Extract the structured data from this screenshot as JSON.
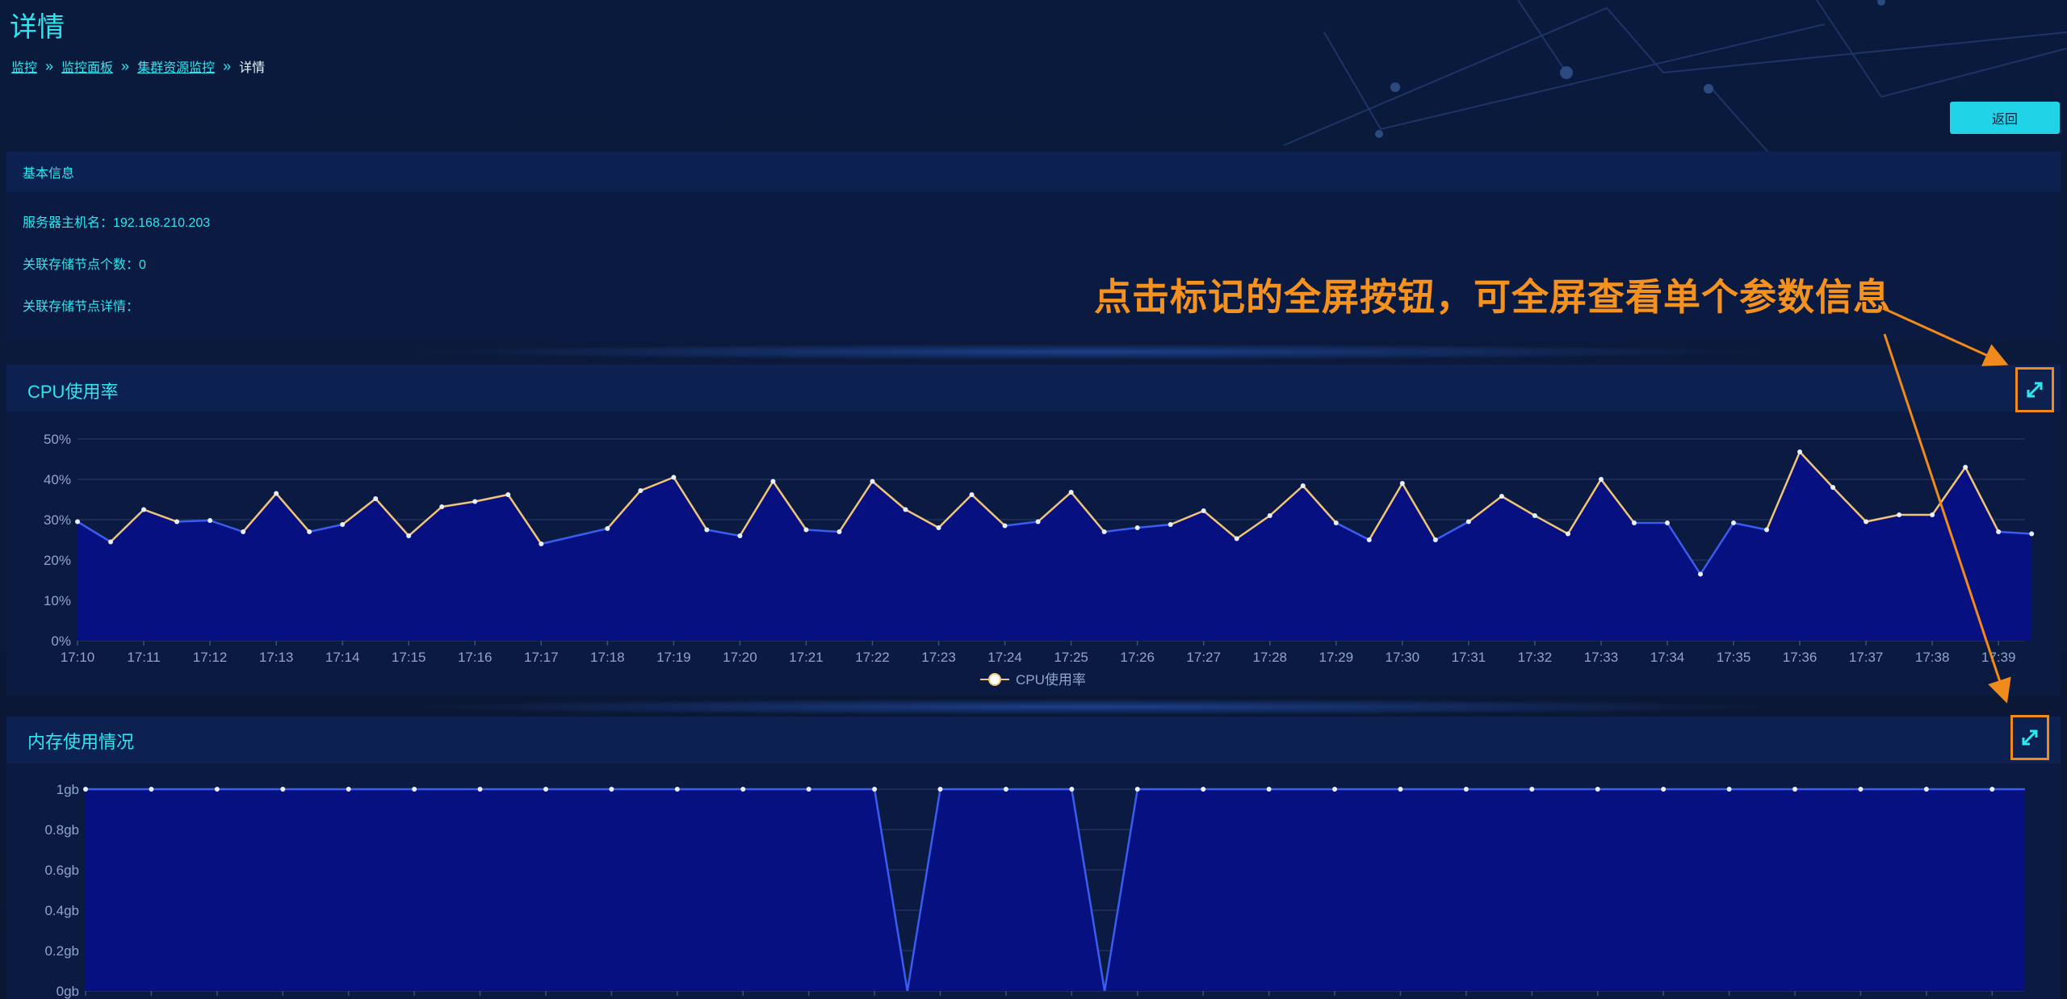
{
  "page": {
    "title": "详情"
  },
  "breadcrumb": [
    {
      "label": "监控",
      "link": true
    },
    {
      "label": "监控面板",
      "link": true
    },
    {
      "label": "集群资源监控",
      "link": true
    },
    {
      "label": "详情",
      "link": false
    }
  ],
  "actions": {
    "back_label": "返回"
  },
  "info_panel": {
    "header": "基本信息",
    "hostname_label": "服务器主机名：192.168.210.203",
    "storage_count_label": "关联存储节点个数：0",
    "storage_detail_label": "关联存储节点详情："
  },
  "annotation": {
    "text": "点击标记的全屏按钮，可全屏查看单个参数信息"
  },
  "icons": {
    "fullscreen": "expand-icon",
    "breadcrumb_separator": "double-chevron-right-icon"
  },
  "colors": {
    "accent": "#2ee6f0",
    "highlight": "#f08a1c",
    "area_fill": "#071080",
    "line": "#3a5cf0",
    "line_warm": "#f0c57a"
  },
  "chart_data": [
    {
      "type": "area",
      "title": "CPU使用率",
      "legend": [
        "CPU使用率"
      ],
      "legend_position": "bottom",
      "x_ticks": [
        "17:10",
        "17:11",
        "17:12",
        "17:13",
        "17:14",
        "17:15",
        "17:16",
        "17:17",
        "17:18",
        "17:19",
        "17:20",
        "17:21",
        "17:22",
        "17:23",
        "17:24",
        "17:25",
        "17:26",
        "17:27",
        "17:28",
        "17:29",
        "17:30",
        "17:31",
        "17:32",
        "17:33",
        "17:34",
        "17:35",
        "17:36",
        "17:37",
        "17:38",
        "17:39"
      ],
      "y_ticks": [
        "0%",
        "10%",
        "20%",
        "30%",
        "40%",
        "50%"
      ],
      "ylim": [
        0,
        50
      ],
      "grid": true,
      "series": [
        {
          "name": "CPU使用率",
          "x": [
            0,
            0.5,
            1,
            1.5,
            2,
            2.5,
            3,
            3.5,
            4,
            4.5,
            5,
            5.5,
            6,
            6.5,
            7,
            8,
            8.5,
            9,
            9.5,
            10,
            10.5,
            11,
            11.5,
            12,
            12.5,
            13,
            13.5,
            14,
            14.5,
            15,
            15.5,
            16,
            16.5,
            17,
            17.5,
            18,
            18.5,
            19,
            19.5,
            20,
            20.5,
            21,
            21.5,
            22,
            22.5,
            23,
            23.5,
            24,
            24.5,
            25,
            25.5,
            26,
            26.5,
            27,
            27.5,
            28,
            28.5,
            29,
            29.5
          ],
          "values": [
            29.5,
            24.5,
            32.5,
            29.5,
            29.8,
            27,
            36.5,
            27,
            28.8,
            35.2,
            26,
            33.2,
            34.5,
            36.2,
            24,
            27.8,
            37.2,
            40.5,
            27.5,
            26,
            39.5,
            27.5,
            27,
            39.5,
            32.5,
            28,
            36.2,
            28.5,
            29.5,
            36.8,
            27,
            28,
            28.8,
            32.2,
            25.3,
            31,
            38.4,
            29.2,
            25,
            39,
            25,
            29.5,
            35.8,
            31,
            26.5,
            40,
            29.2,
            29.2,
            16.5,
            29.2,
            27.5,
            46.8,
            38,
            29.5,
            31.2,
            31.2,
            43,
            27,
            26.5
          ]
        }
      ]
    },
    {
      "type": "area",
      "title": "内存使用情况",
      "y_ticks": [
        "0gb",
        "0.2gb",
        "0.4gb",
        "0.6gb",
        "0.8gb",
        "1gb"
      ],
      "ylim": [
        0,
        1
      ],
      "grid": true,
      "series": [
        {
          "name": "内存使用情况",
          "x": [
            0,
            1,
            2,
            3,
            4,
            5,
            6,
            7,
            8,
            9,
            10,
            11,
            12,
            12.5,
            13,
            14,
            15,
            15.5,
            16,
            17,
            18,
            19,
            20,
            21,
            22,
            23,
            24,
            25,
            26,
            27,
            28,
            29,
            29.5
          ],
          "values": [
            1,
            1,
            1,
            1,
            1,
            1,
            1,
            1,
            1,
            1,
            1,
            1,
            1,
            0,
            1,
            1,
            1,
            0,
            1,
            1,
            1,
            1,
            1,
            1,
            1,
            1,
            1,
            1,
            1,
            1,
            1,
            1,
            1
          ]
        }
      ]
    }
  ]
}
